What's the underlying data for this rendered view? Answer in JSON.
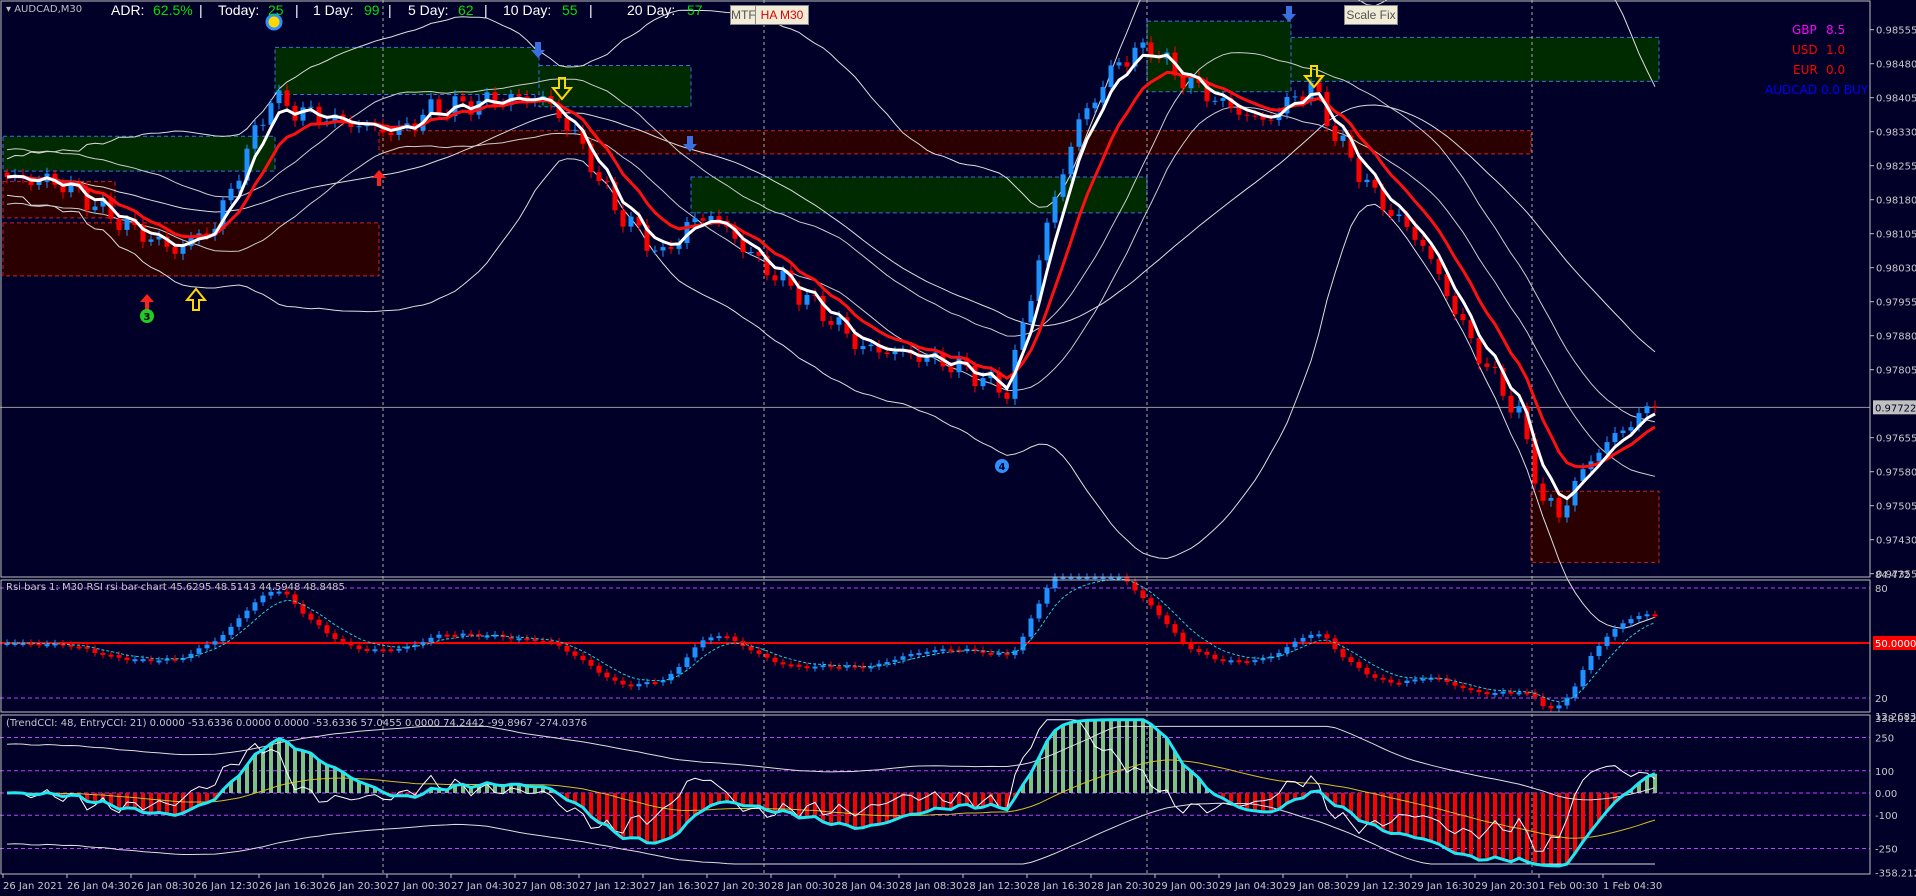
{
  "window": {
    "symbol_label": "AUDCAD,M30"
  },
  "adr_panel": {
    "adr_label": "ADR:",
    "adr_value": "62.5%",
    "today_label": "Today:",
    "today_value": "25",
    "day1_label": "1 Day:",
    "day1_value": "99",
    "day5_label": "5 Day:",
    "day5_value": "62",
    "day10_label": "10 Day:",
    "day10_value": "55",
    "day20_label": "20 Day:",
    "day20_value": "57",
    "separator": "|"
  },
  "buttons": {
    "mtf": "MTF",
    "ha": "HA M30",
    "scale_fix": "Scale Fix"
  },
  "currency_strength": [
    {
      "currency": "GBP",
      "value": "8.5",
      "color": "#ff00ff"
    },
    {
      "currency": "USD",
      "value": "1.0",
      "color": "#ff0000"
    },
    {
      "currency": "EUR",
      "value": "0.0",
      "color": "#ff0000"
    }
  ],
  "signal": {
    "text": "AUDCAD 0.0 BUY",
    "color": "#0000ff"
  },
  "markers": {
    "circle_3": "3",
    "circle_4": "4"
  },
  "rsi_pane": {
    "title": "Rsi bars 1: M30 RSI rsi bar-chart 45.6295 48.5143 44.5948 48.8485",
    "ticks": [
      {
        "label": "84.472",
        "value": 84.472
      },
      {
        "label": "80",
        "value": 80
      },
      {
        "label": "50.0000",
        "value": 50
      },
      {
        "label": "20",
        "value": 20
      },
      {
        "label": "12.2683",
        "value": 12.2683
      }
    ],
    "levels": [
      80,
      50,
      20
    ]
  },
  "cci_pane": {
    "title": "(TrendCCI: 48, EntryCCI: 21)  0.0000 -53.6336 0.0000 0.0000 -53.6336 57.0455 0.0000 74.2442 -99.8967 -274.0376",
    "ticks": [
      {
        "label": "338.0123",
        "value": 338
      },
      {
        "label": "250",
        "value": 250
      },
      {
        "label": "100",
        "value": 100
      },
      {
        "label": "0.00",
        "value": 0
      },
      {
        "label": "-100",
        "value": -100
      },
      {
        "label": "-250",
        "value": -250
      },
      {
        "label": "-358.2123",
        "value": -358
      }
    ],
    "levels": [
      250,
      100,
      0,
      -100,
      -250
    ]
  },
  "colors": {
    "background": "#000028",
    "bull": "#1e90ff",
    "bear": "#ff0000",
    "grid": "#c0c0c0",
    "level": "#c040ff",
    "zone_buy": "#002a00",
    "zone_sell": "#2a0000"
  },
  "chart_data": {
    "type": "candlestick",
    "title": "AUDCAD,M30",
    "ylim": [
      0.9734,
      0.98621
    ],
    "y_ticks": [
      "0.98555",
      "0.98480",
      "0.98405",
      "0.98330",
      "0.98255",
      "0.98180",
      "0.98105",
      "0.98030",
      "0.97955",
      "0.97880",
      "0.97805",
      "0.97655",
      "0.97580",
      "0.97505",
      "0.97430",
      "0.97355"
    ],
    "current_price": "0.97722",
    "x_ticks": [
      "26 Jan 2021",
      "26 Jan 04:30",
      "26 Jan 08:30",
      "26 Jan 12:30",
      "26 Jan 16:30",
      "26 Jan 20:30",
      "27 Jan 00:30",
      "27 Jan 04:30",
      "27 Jan 08:30",
      "27 Jan 12:30",
      "27 Jan 16:30",
      "27 Jan 20:30",
      "28 Jan 00:30",
      "28 Jan 04:30",
      "28 Jan 08:30",
      "28 Jan 12:30",
      "28 Jan 16:30",
      "28 Jan 20:30",
      "29 Jan 00:30",
      "29 Jan 04:30",
      "29 Jan 08:30",
      "29 Jan 12:30",
      "29 Jan 16:30",
      "29 Jan 20:30",
      "1 Feb 00:30",
      "1 Feb 04:30"
    ],
    "bars_per_tick": 8,
    "close_keyframes": [
      [
        0,
        0.9823
      ],
      [
        7,
        0.98216
      ],
      [
        15,
        0.98122
      ],
      [
        21,
        0.98068
      ],
      [
        26,
        0.98122
      ],
      [
        33,
        0.98405
      ],
      [
        36,
        0.98378
      ],
      [
        42,
        0.98351
      ],
      [
        49,
        0.98329
      ],
      [
        53,
        0.98378
      ],
      [
        61,
        0.984
      ],
      [
        67,
        0.98405
      ],
      [
        71,
        0.98324
      ],
      [
        76,
        0.98162
      ],
      [
        82,
        0.98054
      ],
      [
        85,
        0.98122
      ],
      [
        88,
        0.98149
      ],
      [
        94,
        0.98041
      ],
      [
        101,
        0.97947
      ],
      [
        107,
        0.97852
      ],
      [
        113,
        0.97839
      ],
      [
        119,
        0.97812
      ],
      [
        125,
        0.97758
      ],
      [
        128,
        0.97974
      ],
      [
        131,
        0.98189
      ],
      [
        134,
        0.98351
      ],
      [
        139,
        0.98486
      ],
      [
        143,
        0.98518
      ],
      [
        146,
        0.98459
      ],
      [
        152,
        0.98391
      ],
      [
        157,
        0.98351
      ],
      [
        160,
        0.98391
      ],
      [
        163,
        0.98432
      ],
      [
        166,
        0.98324
      ],
      [
        171,
        0.98189
      ],
      [
        177,
        0.98081
      ],
      [
        183,
        0.97866
      ],
      [
        189,
        0.97704
      ],
      [
        192,
        0.97515
      ],
      [
        194,
        0.97488
      ],
      [
        198,
        0.9761
      ],
      [
        203,
        0.9769
      ],
      [
        206,
        0.97722
      ]
    ],
    "zones": [
      {
        "kind": "buy",
        "from_bar": 0,
        "to_bar": 34,
        "high": 0.9832,
        "low": 0.98243
      },
      {
        "kind": "sell",
        "from_bar": 0,
        "to_bar": 14,
        "high": 0.9822,
        "low": 0.9814
      },
      {
        "kind": "sell",
        "from_bar": 0,
        "to_bar": 47,
        "high": 0.98129,
        "low": 0.98012
      },
      {
        "kind": "buy",
        "from_bar": 34,
        "to_bar": 67,
        "high": 0.98516,
        "low": 0.98412
      },
      {
        "kind": "buy",
        "from_bar": 67,
        "to_bar": 86,
        "high": 0.98476,
        "low": 0.98385
      },
      {
        "kind": "sell",
        "from_bar": 47,
        "to_bar": 191,
        "high": 0.98332,
        "low": 0.98281
      },
      {
        "kind": "buy",
        "from_bar": 86,
        "to_bar": 143,
        "high": 0.9823,
        "low": 0.98151
      },
      {
        "kind": "buy",
        "from_bar": 143,
        "to_bar": 161,
        "high": 0.98574,
        "low": 0.98418
      },
      {
        "kind": "buy",
        "from_bar": 161,
        "to_bar": 207,
        "high": 0.98538,
        "low": 0.98441
      },
      {
        "kind": "sell",
        "from_bar": 191,
        "to_bar": 207,
        "high": 0.97537,
        "low": 0.9738
      }
    ]
  }
}
